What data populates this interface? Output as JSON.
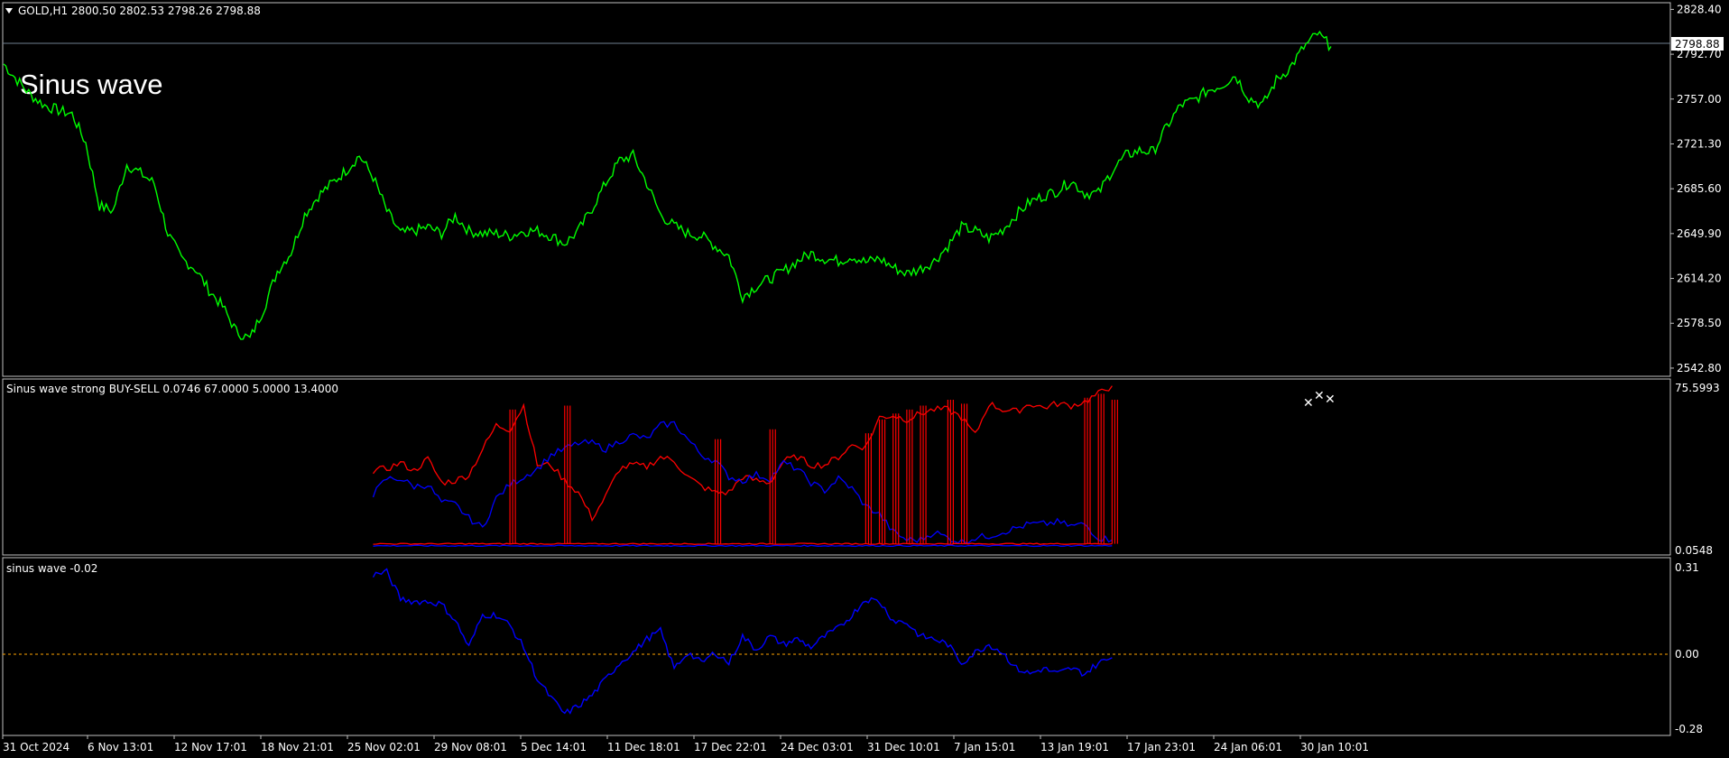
{
  "colors": {
    "background": "#000000",
    "frame": "#c0c0c0",
    "price": "#00ff00",
    "buy_sell_red": "#ff0000",
    "buy_sell_blue": "#0000ff",
    "sinus": "#0000ff",
    "zero_line": "#ffa500",
    "text": "#ffffff"
  },
  "main": {
    "symbol_header": "GOLD,H1  2800.50 2802.53 2798.26 2798.88",
    "overlay_text": "Sinus wave",
    "current_price_label": "2798.88",
    "y_ticks": [
      "2828.40",
      "2792.70",
      "2757.00",
      "2721.30",
      "2685.60",
      "2649.90",
      "2614.20",
      "2578.50",
      "2542.80"
    ]
  },
  "indicator1": {
    "title": "Sinus wave strong BUY-SELL 0.0746 67.0000 5.0000 13.4000",
    "y_top_label": "75.5993",
    "y_bottom_label": "0.0548"
  },
  "indicator2": {
    "title": "sinus wave -0.02",
    "y_ticks": [
      "0.31",
      "0.00",
      "-0.28"
    ]
  },
  "x_ticks": [
    "31 Oct 2024",
    "6 Nov 13:01",
    "12 Nov 17:01",
    "18 Nov 21:01",
    "25 Nov 02:01",
    "29 Nov 08:01",
    "5 Dec 14:01",
    "11 Dec 18:01",
    "17 Dec 22:01",
    "24 Dec 03:01",
    "31 Dec 10:01",
    "7 Jan 15:01",
    "13 Jan 19:01",
    "17 Jan 23:01",
    "24 Jan 06:01",
    "30 Jan 10:01"
  ],
  "chart_data": [
    {
      "type": "line",
      "series": [
        {
          "name": "GOLD,H1",
          "values": [
            2785,
            2772,
            2760,
            2752,
            2748,
            2745,
            2722,
            2672,
            2668,
            2705,
            2698,
            2690,
            2650,
            2630,
            2622,
            2605,
            2592,
            2572,
            2566,
            2590,
            2620,
            2635,
            2665,
            2680,
            2690,
            2700,
            2712,
            2695,
            2668,
            2650,
            2652,
            2655,
            2650,
            2664,
            2652,
            2650,
            2650,
            2648,
            2652,
            2652,
            2648,
            2642,
            2652,
            2670,
            2690,
            2708,
            2712,
            2690,
            2665,
            2656,
            2650,
            2648,
            2640,
            2632,
            2600,
            2608,
            2614,
            2620,
            2628,
            2634,
            2630,
            2628,
            2632,
            2627,
            2630,
            2623,
            2618,
            2622,
            2628,
            2640,
            2655,
            2652,
            2646,
            2653,
            2665,
            2675,
            2680,
            2684,
            2692,
            2682,
            2682,
            2700,
            2712,
            2716,
            2715,
            2735,
            2752,
            2756,
            2764,
            2768,
            2776,
            2758,
            2752,
            2772,
            2782,
            2798,
            2809,
            2798.88
          ]
        }
      ],
      "y_range": [
        2537,
        2833
      ]
    },
    {
      "type": "line",
      "title": "Sinus wave strong BUY-SELL 0.0746 67.0000 5.0000 13.4000",
      "x_start_index": 27,
      "ylim": [
        0,
        80
      ],
      "series": [
        {
          "name": "red",
          "values": [
            39,
            40,
            43,
            39,
            45,
            33,
            34,
            37,
            50,
            62,
            60,
            72,
            42,
            42,
            34,
            28,
            15,
            26,
            40,
            42,
            41,
            46,
            44,
            36,
            31,
            28,
            28,
            36,
            34,
            33,
            44,
            46,
            42,
            42,
            46,
            52,
            51,
            66,
            67,
            65,
            68,
            70,
            70,
            66,
            57,
            73,
            70,
            69,
            73,
            71,
            73,
            72,
            74,
            78,
            82
          ]
        },
        {
          "name": "blue",
          "values": [
            27,
            35,
            35,
            31,
            32,
            23,
            22,
            15,
            10,
            25,
            32,
            36,
            40,
            47,
            50,
            53,
            53,
            50,
            54,
            57,
            55,
            62,
            63,
            55,
            47,
            44,
            36,
            34,
            37,
            35,
            43,
            40,
            33,
            29,
            35,
            30,
            21,
            17,
            8,
            4,
            4,
            8,
            5,
            3,
            5,
            6,
            8,
            10,
            12,
            12,
            13,
            11,
            12,
            5,
            4
          ]
        },
        {
          "name": "red-low",
          "values": [
            2,
            2,
            2,
            2,
            2,
            2,
            2,
            2,
            2,
            2,
            2,
            2,
            2,
            2,
            2,
            2,
            2,
            2,
            2,
            2,
            2,
            2,
            2,
            2,
            2,
            2,
            2,
            2,
            2,
            2,
            2,
            2,
            2,
            2,
            2,
            2,
            2,
            2,
            2,
            2,
            2,
            2,
            2,
            2,
            2,
            2,
            2,
            2,
            2,
            2,
            2,
            2,
            2,
            2,
            2
          ]
        },
        {
          "name": "blue-low",
          "values": [
            1,
            1,
            1,
            1,
            1,
            1,
            1,
            1,
            1,
            1,
            1,
            1,
            1,
            1,
            1,
            1,
            1,
            1,
            1,
            1,
            1,
            1,
            1,
            1,
            1,
            1,
            1,
            1,
            1,
            1,
            1,
            1,
            1,
            1,
            1,
            1,
            1,
            1,
            1,
            1,
            1,
            1,
            1,
            1,
            1,
            1,
            1,
            1,
            1,
            1,
            1,
            1,
            1,
            1,
            1
          ]
        }
      ],
      "spikes": [
        {
          "x": 37,
          "y": 70
        },
        {
          "x": 41,
          "y": 72
        },
        {
          "x": 52,
          "y": 55
        },
        {
          "x": 56,
          "y": 60
        },
        {
          "x": 63,
          "y": 58
        },
        {
          "x": 64,
          "y": 65
        },
        {
          "x": 65,
          "y": 68
        },
        {
          "x": 66,
          "y": 70
        },
        {
          "x": 67,
          "y": 72
        },
        {
          "x": 69,
          "y": 75
        },
        {
          "x": 70,
          "y": 73
        },
        {
          "x": 79,
          "y": 76
        },
        {
          "x": 80,
          "y": 78
        },
        {
          "x": 81,
          "y": 75
        }
      ]
    },
    {
      "type": "line",
      "title": "sinus wave -0.02",
      "x_start_index": 27,
      "ylim": [
        -0.28,
        0.31
      ],
      "series": [
        {
          "name": "sinus wave",
          "values": [
            0.29,
            0.3,
            0.2,
            0.19,
            0.19,
            0.18,
            0.12,
            0.02,
            0.14,
            0.14,
            0.1,
            0.02,
            -0.1,
            -0.17,
            -0.23,
            -0.2,
            -0.16,
            -0.1,
            -0.04,
            0.0,
            0.05,
            0.08,
            -0.06,
            0.0,
            -0.04,
            0.0,
            -0.04,
            0.06,
            0.01,
            0.06,
            0.03,
            0.05,
            0.02,
            0.06,
            0.09,
            0.14,
            0.2,
            0.19,
            0.12,
            0.11,
            0.06,
            0.05,
            0.03,
            -0.04,
            0.0,
            0.03,
            0.0,
            -0.06,
            -0.08,
            -0.06,
            -0.08,
            -0.06,
            -0.08,
            -0.04,
            -0.02
          ]
        }
      ]
    }
  ]
}
